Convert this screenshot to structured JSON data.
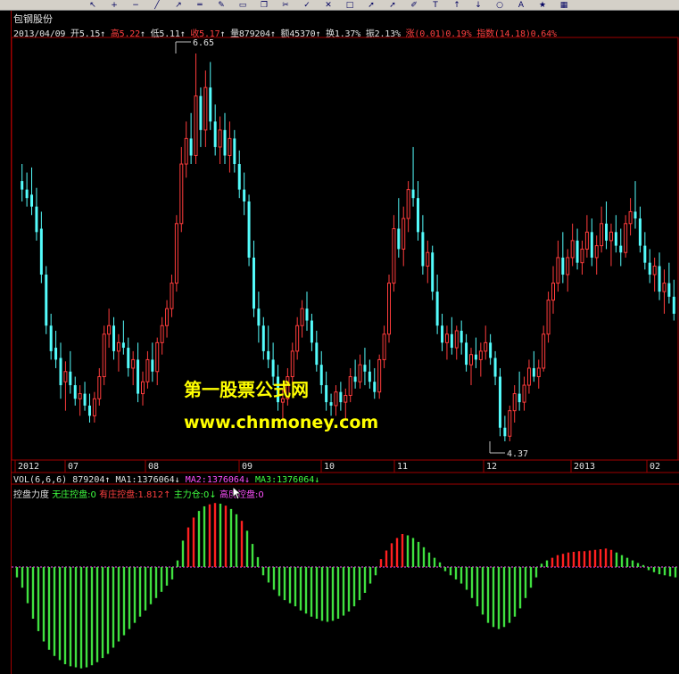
{
  "stock_name": "包钢股份",
  "quote": {
    "date": "2013/04/09",
    "open_label": "开",
    "open": "5.15",
    "high_label": "高",
    "high": "5.22",
    "low_label": "低",
    "low": "5.11",
    "close_label": "收",
    "close": "5.17",
    "volume_label": "量",
    "volume": "879204",
    "amount_label": "额",
    "amount": "45370",
    "turnover_label": "换",
    "turnover": "1.37%",
    "amplitude_label": "振",
    "amplitude": "2.13%",
    "change_label": "涨",
    "change": "(0.01)",
    "change_pct": "0.19%",
    "index_label": "指数",
    "index_change": "(14.18)",
    "index_pct": "0.64%"
  },
  "price_annotations": {
    "max_price": "6.65",
    "min_price": "4.37"
  },
  "watermark": {
    "title": "第一股票公式网",
    "url": "www.chnmoney.com"
  },
  "time_axis": [
    "2012",
    "07",
    "08",
    "09",
    "10",
    "11",
    "12",
    "2013",
    "02"
  ],
  "volume_line": {
    "name": "VOL(6,6,6)",
    "value": "879204",
    "ma1": "MA1:1376064",
    "ma2": "MA2:1376064",
    "ma3": "MA3:1376064"
  },
  "indicator_line": {
    "name": "控盘力度",
    "item1": "无庄控盘:0",
    "item2": "有庄控盘:1.812",
    "item3_a": "主力",
    "item3_b": "仓:0",
    "item4": "高度控盘:0"
  },
  "colors": {
    "up": "#ff3c3c",
    "down": "#54fcfc",
    "histogram_up": "#ff2020",
    "histogram_down": "#40e040",
    "frame": "#a00000",
    "text_white": "#e0e0e0",
    "text_yellow": "#ffff00",
    "text_magenta": "#ff50ff",
    "text_green": "#40ff40",
    "text_red": "#ff4040"
  },
  "toolbar_icons": [
    "cursor-icon",
    "zoom-in-icon",
    "zoom-out-icon",
    "line-icon",
    "ray-icon",
    "hline-icon",
    "pen-icon",
    "eraser-icon",
    "copy-icon",
    "cut-icon",
    "check-icon",
    "x-icon",
    "rect-icon",
    "arrow-icon",
    "arrow-icon",
    "pencil-icon",
    "text-icon",
    "up-arrow-icon",
    "down-arrow-icon",
    "circle-icon",
    "text-a-icon",
    "star-icon",
    "color-icon"
  ],
  "chart_data": {
    "type": "candlestick",
    "ylim": [
      4.2,
      6.8
    ],
    "candles": [
      {
        "o": 5.9,
        "h": 6.0,
        "l": 5.78,
        "c": 5.85
      },
      {
        "o": 5.85,
        "h": 5.95,
        "l": 5.75,
        "c": 5.8
      },
      {
        "o": 5.82,
        "h": 5.98,
        "l": 5.7,
        "c": 5.75
      },
      {
        "o": 5.75,
        "h": 5.86,
        "l": 5.55,
        "c": 5.6
      },
      {
        "o": 5.62,
        "h": 5.72,
        "l": 5.3,
        "c": 5.35
      },
      {
        "o": 5.35,
        "h": 5.4,
        "l": 5.0,
        "c": 5.05
      },
      {
        "o": 5.05,
        "h": 5.12,
        "l": 4.85,
        "c": 4.9
      },
      {
        "o": 4.92,
        "h": 5.02,
        "l": 4.8,
        "c": 4.85
      },
      {
        "o": 4.86,
        "h": 4.95,
        "l": 4.62,
        "c": 4.7
      },
      {
        "o": 4.72,
        "h": 4.84,
        "l": 4.55,
        "c": 4.78
      },
      {
        "o": 4.78,
        "h": 4.9,
        "l": 4.65,
        "c": 4.7
      },
      {
        "o": 4.7,
        "h": 4.75,
        "l": 4.58,
        "c": 4.62
      },
      {
        "o": 4.62,
        "h": 4.7,
        "l": 4.52,
        "c": 4.65
      },
      {
        "o": 4.65,
        "h": 4.72,
        "l": 4.55,
        "c": 4.58
      },
      {
        "o": 4.58,
        "h": 4.65,
        "l": 4.48,
        "c": 4.52
      },
      {
        "o": 4.52,
        "h": 4.66,
        "l": 4.48,
        "c": 4.62
      },
      {
        "o": 4.62,
        "h": 4.8,
        "l": 4.58,
        "c": 4.75
      },
      {
        "o": 4.75,
        "h": 5.05,
        "l": 4.7,
        "c": 5.0
      },
      {
        "o": 5.0,
        "h": 5.15,
        "l": 4.92,
        "c": 5.05
      },
      {
        "o": 5.05,
        "h": 5.1,
        "l": 4.85,
        "c": 4.9
      },
      {
        "o": 4.9,
        "h": 5.0,
        "l": 4.78,
        "c": 4.95
      },
      {
        "o": 4.95,
        "h": 5.08,
        "l": 4.88,
        "c": 4.92
      },
      {
        "o": 4.92,
        "h": 4.98,
        "l": 4.75,
        "c": 4.8
      },
      {
        "o": 4.8,
        "h": 4.9,
        "l": 4.7,
        "c": 4.85
      },
      {
        "o": 4.85,
        "h": 4.95,
        "l": 4.6,
        "c": 4.65
      },
      {
        "o": 4.65,
        "h": 4.78,
        "l": 4.58,
        "c": 4.72
      },
      {
        "o": 4.72,
        "h": 4.9,
        "l": 4.68,
        "c": 4.85
      },
      {
        "o": 4.85,
        "h": 4.95,
        "l": 4.72,
        "c": 4.78
      },
      {
        "o": 4.78,
        "h": 4.98,
        "l": 4.7,
        "c": 4.95
      },
      {
        "o": 4.95,
        "h": 5.1,
        "l": 4.88,
        "c": 5.05
      },
      {
        "o": 5.05,
        "h": 5.2,
        "l": 4.98,
        "c": 5.15
      },
      {
        "o": 5.15,
        "h": 5.35,
        "l": 5.1,
        "c": 5.3
      },
      {
        "o": 5.3,
        "h": 5.7,
        "l": 5.25,
        "c": 5.65
      },
      {
        "o": 5.65,
        "h": 6.1,
        "l": 5.6,
        "c": 6.0
      },
      {
        "o": 6.0,
        "h": 6.25,
        "l": 5.92,
        "c": 6.15
      },
      {
        "o": 6.15,
        "h": 6.3,
        "l": 6.0,
        "c": 6.05
      },
      {
        "o": 6.05,
        "h": 6.65,
        "l": 6.0,
        "c": 6.4
      },
      {
        "o": 6.4,
        "h": 6.45,
        "l": 6.1,
        "c": 6.2
      },
      {
        "o": 6.2,
        "h": 6.55,
        "l": 6.1,
        "c": 6.45
      },
      {
        "o": 6.45,
        "h": 6.6,
        "l": 6.2,
        "c": 6.25
      },
      {
        "o": 6.25,
        "h": 6.35,
        "l": 6.05,
        "c": 6.1
      },
      {
        "o": 6.1,
        "h": 6.28,
        "l": 6.0,
        "c": 6.2
      },
      {
        "o": 6.2,
        "h": 6.3,
        "l": 6.0,
        "c": 6.05
      },
      {
        "o": 6.05,
        "h": 6.25,
        "l": 5.95,
        "c": 6.15
      },
      {
        "o": 6.15,
        "h": 6.2,
        "l": 5.95,
        "c": 6.0
      },
      {
        "o": 6.0,
        "h": 6.08,
        "l": 5.8,
        "c": 5.85
      },
      {
        "o": 5.85,
        "h": 5.95,
        "l": 5.7,
        "c": 5.78
      },
      {
        "o": 5.78,
        "h": 5.82,
        "l": 5.4,
        "c": 5.45
      },
      {
        "o": 5.45,
        "h": 5.55,
        "l": 5.1,
        "c": 5.15
      },
      {
        "o": 5.15,
        "h": 5.25,
        "l": 4.95,
        "c": 5.05
      },
      {
        "o": 5.05,
        "h": 5.1,
        "l": 4.85,
        "c": 4.9
      },
      {
        "o": 4.9,
        "h": 5.05,
        "l": 4.8,
        "c": 4.85
      },
      {
        "o": 4.85,
        "h": 4.95,
        "l": 4.7,
        "c": 4.75
      },
      {
        "o": 4.75,
        "h": 4.82,
        "l": 4.55,
        "c": 4.6
      },
      {
        "o": 4.6,
        "h": 4.68,
        "l": 4.5,
        "c": 4.62
      },
      {
        "o": 4.62,
        "h": 4.8,
        "l": 4.58,
        "c": 4.75
      },
      {
        "o": 4.75,
        "h": 4.95,
        "l": 4.7,
        "c": 4.9
      },
      {
        "o": 4.9,
        "h": 5.1,
        "l": 4.85,
        "c": 5.05
      },
      {
        "o": 5.05,
        "h": 5.2,
        "l": 4.98,
        "c": 5.15
      },
      {
        "o": 5.15,
        "h": 5.25,
        "l": 5.02,
        "c": 5.08
      },
      {
        "o": 5.08,
        "h": 5.12,
        "l": 4.9,
        "c": 4.95
      },
      {
        "o": 4.95,
        "h": 5.02,
        "l": 4.78,
        "c": 4.82
      },
      {
        "o": 4.82,
        "h": 4.9,
        "l": 4.65,
        "c": 4.7
      },
      {
        "o": 4.7,
        "h": 4.78,
        "l": 4.55,
        "c": 4.6
      },
      {
        "o": 4.6,
        "h": 4.65,
        "l": 4.52,
        "c": 4.58
      },
      {
        "o": 4.58,
        "h": 4.7,
        "l": 4.52,
        "c": 4.66
      },
      {
        "o": 4.66,
        "h": 4.72,
        "l": 4.55,
        "c": 4.6
      },
      {
        "o": 4.6,
        "h": 4.68,
        "l": 4.5,
        "c": 4.64
      },
      {
        "o": 4.64,
        "h": 4.8,
        "l": 4.6,
        "c": 4.75
      },
      {
        "o": 4.75,
        "h": 4.85,
        "l": 4.68,
        "c": 4.72
      },
      {
        "o": 4.72,
        "h": 4.88,
        "l": 4.68,
        "c": 4.82
      },
      {
        "o": 4.82,
        "h": 4.92,
        "l": 4.7,
        "c": 4.78
      },
      {
        "o": 4.78,
        "h": 4.85,
        "l": 4.68,
        "c": 4.72
      },
      {
        "o": 4.72,
        "h": 4.8,
        "l": 4.62,
        "c": 4.66
      },
      {
        "o": 4.66,
        "h": 4.88,
        "l": 4.62,
        "c": 4.85
      },
      {
        "o": 4.85,
        "h": 5.05,
        "l": 4.8,
        "c": 5.0
      },
      {
        "o": 5.0,
        "h": 5.35,
        "l": 4.95,
        "c": 5.3
      },
      {
        "o": 5.3,
        "h": 5.7,
        "l": 5.25,
        "c": 5.62
      },
      {
        "o": 5.62,
        "h": 5.8,
        "l": 5.45,
        "c": 5.5
      },
      {
        "o": 5.5,
        "h": 5.75,
        "l": 5.4,
        "c": 5.68
      },
      {
        "o": 5.68,
        "h": 5.9,
        "l": 5.6,
        "c": 5.85
      },
      {
        "o": 5.85,
        "h": 6.1,
        "l": 5.75,
        "c": 5.8
      },
      {
        "o": 5.8,
        "h": 5.9,
        "l": 5.55,
        "c": 5.6
      },
      {
        "o": 5.6,
        "h": 5.7,
        "l": 5.35,
        "c": 5.4
      },
      {
        "o": 5.4,
        "h": 5.55,
        "l": 5.3,
        "c": 5.48
      },
      {
        "o": 5.48,
        "h": 5.52,
        "l": 5.2,
        "c": 5.25
      },
      {
        "o": 5.25,
        "h": 5.35,
        "l": 5.0,
        "c": 5.05
      },
      {
        "o": 5.05,
        "h": 5.12,
        "l": 4.9,
        "c": 4.95
      },
      {
        "o": 4.95,
        "h": 5.05,
        "l": 4.85,
        "c": 5.0
      },
      {
        "o": 5.0,
        "h": 5.1,
        "l": 4.88,
        "c": 4.92
      },
      {
        "o": 4.92,
        "h": 5.05,
        "l": 4.85,
        "c": 5.02
      },
      {
        "o": 5.02,
        "h": 5.08,
        "l": 4.88,
        "c": 4.95
      },
      {
        "o": 4.95,
        "h": 5.0,
        "l": 4.78,
        "c": 4.82
      },
      {
        "o": 4.82,
        "h": 4.92,
        "l": 4.7,
        "c": 4.88
      },
      {
        "o": 4.88,
        "h": 4.98,
        "l": 4.8,
        "c": 4.85
      },
      {
        "o": 4.85,
        "h": 4.95,
        "l": 4.75,
        "c": 4.9
      },
      {
        "o": 4.9,
        "h": 5.05,
        "l": 4.85,
        "c": 4.95
      },
      {
        "o": 4.95,
        "h": 5.0,
        "l": 4.82,
        "c": 4.86
      },
      {
        "o": 4.86,
        "h": 4.9,
        "l": 4.7,
        "c": 4.75
      },
      {
        "o": 4.75,
        "h": 4.8,
        "l": 4.4,
        "c": 4.45
      },
      {
        "o": 4.45,
        "h": 4.52,
        "l": 4.37,
        "c": 4.4
      },
      {
        "o": 4.4,
        "h": 4.58,
        "l": 4.37,
        "c": 4.55
      },
      {
        "o": 4.55,
        "h": 4.7,
        "l": 4.48,
        "c": 4.65
      },
      {
        "o": 4.65,
        "h": 4.78,
        "l": 4.55,
        "c": 4.6
      },
      {
        "o": 4.6,
        "h": 4.75,
        "l": 4.55,
        "c": 4.7
      },
      {
        "o": 4.7,
        "h": 4.85,
        "l": 4.65,
        "c": 4.8
      },
      {
        "o": 4.8,
        "h": 4.9,
        "l": 4.72,
        "c": 4.75
      },
      {
        "o": 4.75,
        "h": 4.85,
        "l": 4.68,
        "c": 4.8
      },
      {
        "o": 4.8,
        "h": 5.05,
        "l": 4.78,
        "c": 5.0
      },
      {
        "o": 5.0,
        "h": 5.25,
        "l": 4.95,
        "c": 5.2
      },
      {
        "o": 5.2,
        "h": 5.4,
        "l": 5.12,
        "c": 5.3
      },
      {
        "o": 5.3,
        "h": 5.55,
        "l": 5.25,
        "c": 5.45
      },
      {
        "o": 5.45,
        "h": 5.6,
        "l": 5.3,
        "c": 5.35
      },
      {
        "o": 5.35,
        "h": 5.5,
        "l": 5.25,
        "c": 5.45
      },
      {
        "o": 5.45,
        "h": 5.65,
        "l": 5.4,
        "c": 5.55
      },
      {
        "o": 5.55,
        "h": 5.62,
        "l": 5.38,
        "c": 5.42
      },
      {
        "o": 5.42,
        "h": 5.55,
        "l": 5.35,
        "c": 5.5
      },
      {
        "o": 5.5,
        "h": 5.7,
        "l": 5.45,
        "c": 5.6
      },
      {
        "o": 5.6,
        "h": 5.68,
        "l": 5.4,
        "c": 5.45
      },
      {
        "o": 5.45,
        "h": 5.58,
        "l": 5.35,
        "c": 5.52
      },
      {
        "o": 5.52,
        "h": 5.75,
        "l": 5.48,
        "c": 5.65
      },
      {
        "o": 5.65,
        "h": 5.78,
        "l": 5.5,
        "c": 5.55
      },
      {
        "o": 5.55,
        "h": 5.65,
        "l": 5.4,
        "c": 5.6
      },
      {
        "o": 5.6,
        "h": 5.7,
        "l": 5.48,
        "c": 5.52
      },
      {
        "o": 5.52,
        "h": 5.62,
        "l": 5.4,
        "c": 5.48
      },
      {
        "o": 5.48,
        "h": 5.7,
        "l": 5.45,
        "c": 5.65
      },
      {
        "o": 5.65,
        "h": 5.8,
        "l": 5.58,
        "c": 5.72
      },
      {
        "o": 5.72,
        "h": 5.9,
        "l": 5.62,
        "c": 5.68
      },
      {
        "o": 5.68,
        "h": 5.75,
        "l": 5.48,
        "c": 5.52
      },
      {
        "o": 5.52,
        "h": 5.6,
        "l": 5.38,
        "c": 5.42
      },
      {
        "o": 5.42,
        "h": 5.5,
        "l": 5.3,
        "c": 5.35
      },
      {
        "o": 5.35,
        "h": 5.45,
        "l": 5.25,
        "c": 5.4
      },
      {
        "o": 5.4,
        "h": 5.48,
        "l": 5.2,
        "c": 5.25
      },
      {
        "o": 5.25,
        "h": 5.38,
        "l": 5.12,
        "c": 5.3
      },
      {
        "o": 5.3,
        "h": 5.42,
        "l": 5.18,
        "c": 5.22
      },
      {
        "o": 5.22,
        "h": 5.32,
        "l": 5.08,
        "c": 5.12
      }
    ],
    "indicator": [
      -0.1,
      -0.2,
      -0.35,
      -0.5,
      -0.62,
      -0.72,
      -0.8,
      -0.86,
      -0.9,
      -0.94,
      -0.96,
      -0.97,
      -0.98,
      -0.97,
      -0.95,
      -0.92,
      -0.88,
      -0.84,
      -0.78,
      -0.72,
      -0.66,
      -0.6,
      -0.54,
      -0.48,
      -0.42,
      -0.36,
      -0.3,
      -0.24,
      -0.18,
      -0.12,
      0.1,
      0.4,
      0.6,
      0.75,
      0.85,
      0.92,
      0.95,
      0.97,
      0.96,
      0.93,
      0.88,
      0.8,
      0.7,
      0.55,
      0.35,
      0.15,
      -0.08,
      -0.15,
      -0.22,
      -0.28,
      -0.32,
      -0.35,
      -0.38,
      -0.42,
      -0.45,
      -0.48,
      -0.5,
      -0.52,
      -0.53,
      -0.52,
      -0.5,
      -0.47,
      -0.43,
      -0.38,
      -0.32,
      -0.25,
      -0.16,
      -0.08,
      0.12,
      0.25,
      0.36,
      0.44,
      0.5,
      0.48,
      0.44,
      0.38,
      0.3,
      0.22,
      0.14,
      0.07,
      -0.04,
      -0.08,
      -0.12,
      -0.16,
      -0.22,
      -0.3,
      -0.38,
      -0.46,
      -0.54,
      -0.58,
      -0.6,
      -0.58,
      -0.54,
      -0.48,
      -0.4,
      -0.3,
      -0.2,
      -0.1,
      0.05,
      0.1,
      0.14,
      0.18,
      0.2,
      0.22,
      0.23,
      0.24,
      0.24,
      0.25,
      0.26,
      0.27,
      0.28,
      0.26,
      0.22,
      0.18,
      0.14,
      0.1,
      0.06,
      0.03,
      -0.03,
      -0.05,
      -0.07,
      -0.08,
      -0.09,
      -0.1
    ]
  }
}
